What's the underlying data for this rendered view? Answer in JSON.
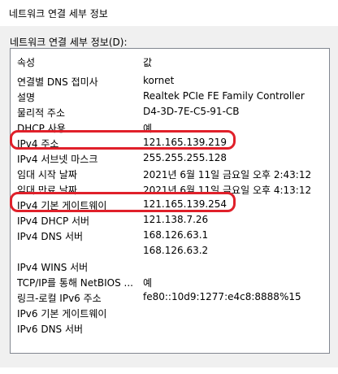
{
  "window": {
    "title": "네트워크 연결 세부 정보"
  },
  "section_label": "네트워크 연결 세부 정보(D):",
  "columns": {
    "property": "속성",
    "value": "값"
  },
  "rows": [
    {
      "property": "연결별 DNS 접미사",
      "value": "kornet"
    },
    {
      "property": "설명",
      "value": "Realtek PCIe FE Family Controller"
    },
    {
      "property": "물리적 주소",
      "value": "D4-3D-7E-C5-91-CB"
    },
    {
      "property": "DHCP 사용",
      "value": "예"
    },
    {
      "property": "IPv4 주소",
      "value": "121.165.139.219"
    },
    {
      "property": "IPv4 서브넷 마스크",
      "value": "255.255.255.128"
    },
    {
      "property": "임대 시작 날짜",
      "value": "2021년 6월 11일 금요일 오후 2:43:12"
    },
    {
      "property": "임대 만료 날짜",
      "value": "2021년 6월 11일 금요일 오후 4:13:12"
    },
    {
      "property": "IPv4 기본 게이트웨이",
      "value": "121.165.139.254"
    },
    {
      "property": "IPv4 DHCP 서버",
      "value": "121.138.7.26"
    },
    {
      "property": "IPv4 DNS 서버",
      "value": "168.126.63.1"
    },
    {
      "property": "",
      "value": "168.126.63.2"
    },
    {
      "property": "IPv4 WINS 서버",
      "value": ""
    },
    {
      "property": "TCP/IP를 통해 NetBIOS ...",
      "value": "예"
    },
    {
      "property": "링크-로컬 IPv6 주소",
      "value": "fe80::10d9:1277:e4c8:8888%15"
    },
    {
      "property": "IPv6 기본 게이트웨이",
      "value": ""
    },
    {
      "property": "IPv6 DNS 서버",
      "value": ""
    }
  ],
  "highlight_color": "#e0202a"
}
